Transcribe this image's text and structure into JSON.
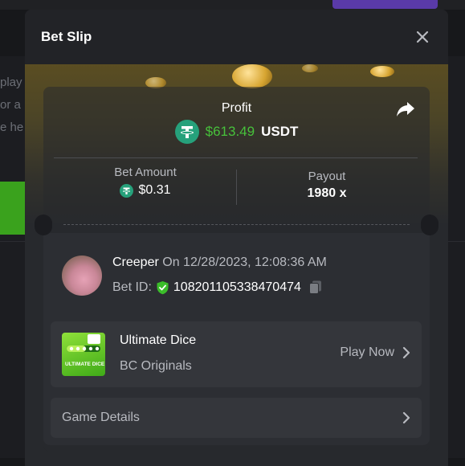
{
  "modal": {
    "title": "Bet Slip"
  },
  "background_text": [
    "play",
    "or a",
    "e he"
  ],
  "profit": {
    "label": "Profit",
    "value": "$613.49",
    "currency": "USDT"
  },
  "bet_amount": {
    "label": "Bet Amount",
    "value": "$0.31"
  },
  "payout": {
    "label": "Payout",
    "value": "1980 x"
  },
  "user": {
    "name": "Creeper",
    "date_text": "On 12/28/2023, 12:08:36 AM",
    "bet_id_label": "Bet ID:",
    "bet_id": "108201105338470474"
  },
  "game": {
    "name": "Ultimate Dice",
    "provider": "BC Originals",
    "thumb_text": "ULTIMATE DICE",
    "play_label": "Play Now"
  },
  "details": {
    "label": "Game Details"
  },
  "colors": {
    "profit_green": "#47c13b",
    "tether_green": "#26a17b",
    "verified_green": "#3bbd2a"
  },
  "icons": [
    "close-icon",
    "share-icon",
    "tether-icon",
    "verified-shield-icon",
    "copy-icon",
    "chevron-right-icon"
  ]
}
